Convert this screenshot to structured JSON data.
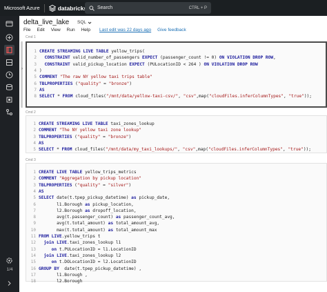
{
  "topbar": {
    "brand": "Microsoft Azure",
    "product": "databricks",
    "search_placeholder": "Search",
    "search_shortcut": "CTRL + P"
  },
  "notebook": {
    "title": "delta_live_lake",
    "language": "SQL",
    "menu": [
      "File",
      "Edit",
      "View",
      "Run",
      "Help"
    ],
    "last_edit": "Last edit was 22 days ago",
    "feedback": "Give feedback"
  },
  "rail": {
    "pager": "1/4"
  },
  "cells": [
    {
      "label": "Cmd 1",
      "lines": [
        "CREATE STREAMING LIVE TABLE yellow_trips(",
        "  CONSTRAINT valid_number_of_passengers EXPECT (passenger_count != 0) ON VIOLATION DROP ROW,",
        "  CONSTRAINT valid_pickup_location EXPECT (PULocationID < 264 ) ON VIOLATION DROP ROW",
        ")",
        "COMMENT \"The raw NY yellow taxi trips table\"",
        "TBLPROPERTIES (\"quality\" = \"bronze\")",
        "AS",
        "SELECT * FROM cloud_files(\"/mnt/data/yellow-taxi-csv/\", \"csv\",map(\"cloudFiles.inferColumnTypes\", \"true\"));"
      ]
    },
    {
      "label": "Cmd 2",
      "lines": [
        "CREATE STREAMING LIVE TABLE taxi_zones_lookup",
        "COMMENT \"The NY yellow taxi zone lookup\"",
        "TBLPROPERTIES (\"quality\" = \"bronze\")",
        "AS",
        "SELECT * FROM cloud_files(\"/mnt/data/my_taxi_lookups/\", \"csv\",map(\"cloudFiles.inferColumnTypes\", \"true\"));"
      ]
    },
    {
      "label": "Cmd 3",
      "lines": [
        "CREATE LIVE TABLE yellow_trips_metrics",
        "COMMENT \"Aggregation by pickup location\"",
        "TBLPROPERTIES (\"quality\" = \"silver\")",
        "AS",
        "SELECT date(t.tpep_pickup_datetime) as pickup_date,",
        "       l1.Borough as pickup_location,",
        "       l2.Borough as dropoff_location,",
        "       avg(t.passenger_count) as passenger_count_avg,",
        "       avg(t.total_amount) as total_amount_avg,",
        "       max(t.total_amount) as total_amount_max",
        "FROM LIVE.yellow_trips t",
        "  join LIVE.taxi_zones_lookup l1",
        "     on t.PULocationID = l1.LocationID",
        "  join LIVE.taxi_zones_lookup l2",
        "     on t.DOLocationID = l2.LocationID",
        "GROUP BY  date(t.tpep_pickup_datetime) ,",
        "       l1.Borough ,",
        "       l2.Borough"
      ]
    }
  ]
}
